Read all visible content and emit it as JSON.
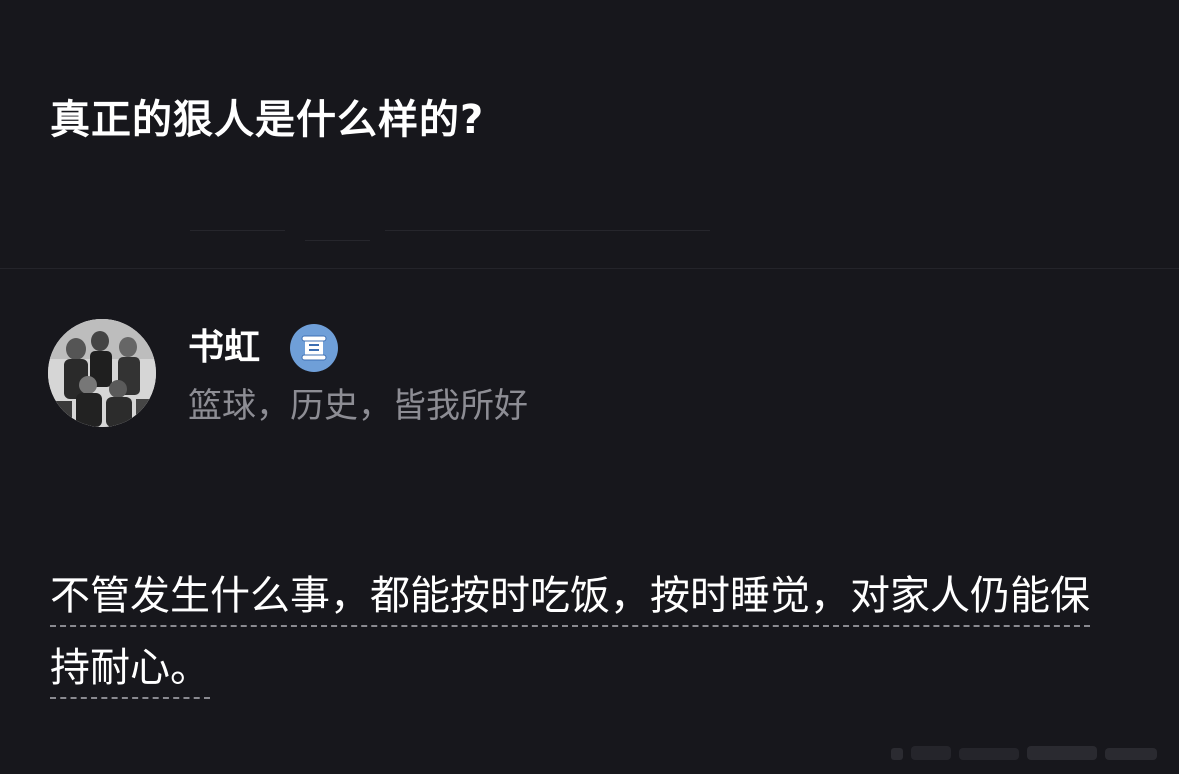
{
  "question": {
    "title": "真正的狠人是什么样的?"
  },
  "author": {
    "name": "书虹",
    "bio": "篮球，历史，皆我所好",
    "avatar_icon": "avatar-photo",
    "badge_icon": "scroll-badge-icon"
  },
  "answer": {
    "text": "不管发生什么事，都能按时吃饭，按时睡觉，对家人仍能保持耐心。"
  },
  "colors": {
    "background": "#17171c",
    "title": "#ffffff",
    "bio": "#8d8d94",
    "badge": "#6f9fd8",
    "underline": "#8a8a90"
  }
}
